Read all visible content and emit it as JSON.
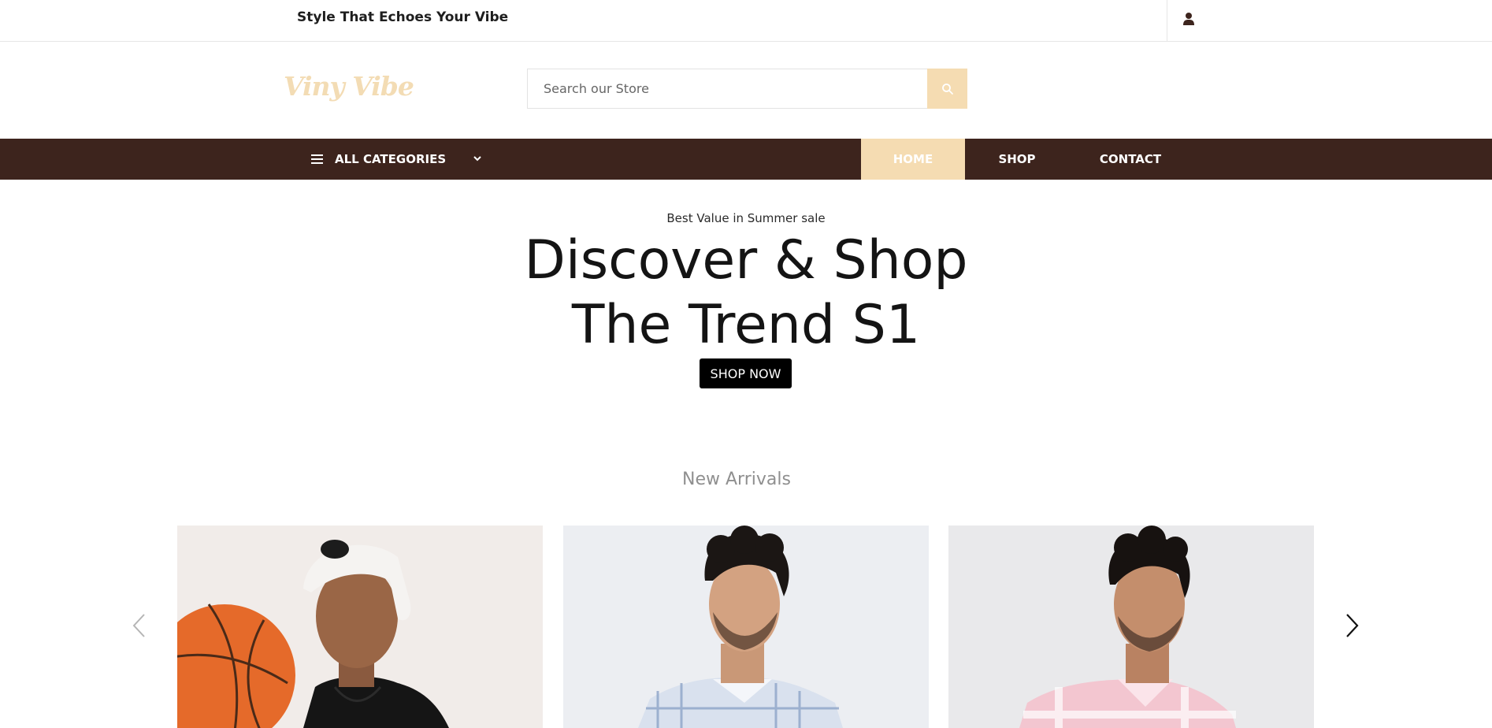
{
  "topbar": {
    "tagline": "Style That Echoes Your Vibe",
    "account_icon": "user-icon"
  },
  "header": {
    "logo_text": "Viny Vibe",
    "search": {
      "placeholder": "Search our Store",
      "value": "",
      "button_icon": "search-icon"
    }
  },
  "nav": {
    "categories_label": "ALL CATEGORIES",
    "categories_icon": "hamburger-icon",
    "categories_chevron": "chevron-down-icon",
    "items": [
      {
        "label": "HOME",
        "active": true
      },
      {
        "label": "SHOP",
        "active": false
      },
      {
        "label": "CONTACT",
        "active": false
      }
    ],
    "colors": {
      "bar": "#3d241d",
      "accent": "#f5dcb2"
    }
  },
  "hero": {
    "kicker": "Best Value in Summer sale",
    "title_line1": "Discover & Shop",
    "title_line2": "The Trend S1",
    "cta": "SHOP NOW"
  },
  "new_arrivals": {
    "title": "New Arrivals",
    "prev_icon": "chevron-left-icon",
    "next_icon": "chevron-right-icon",
    "products": [
      {
        "image": "man in black t-shirt and white cap holding basketball"
      },
      {
        "image": "man in blue checked shirt"
      },
      {
        "image": "man in pink checked shirt"
      }
    ]
  }
}
